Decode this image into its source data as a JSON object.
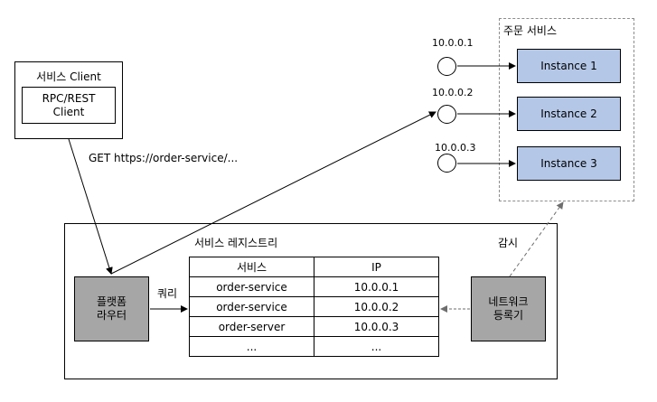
{
  "client": {
    "title": "서비스 Client",
    "inner_line1": "RPC/REST",
    "inner_line2": "Client"
  },
  "request_label": "GET https://order-service/...",
  "order_service": {
    "title": "주문 서비스",
    "instances": [
      {
        "ip": "10.0.0.1",
        "label": "Instance 1"
      },
      {
        "ip": "10.0.0.2",
        "label": "Instance 2"
      },
      {
        "ip": "10.0.0.3",
        "label": "Instance 3"
      }
    ]
  },
  "registry": {
    "title": "서비스 레지스트리",
    "headers": [
      "서비스",
      "IP"
    ],
    "rows": [
      [
        "order-service",
        "10.0.0.1"
      ],
      [
        "order-service",
        "10.0.0.2"
      ],
      [
        "order-server",
        "10.0.0.3"
      ],
      [
        "...",
        "..."
      ]
    ]
  },
  "router": {
    "line1": "플랫폼",
    "line2": "라우터"
  },
  "query_label": "쿼리",
  "monitor": {
    "line1": "네트워크",
    "line2": "등록기"
  },
  "watch_label": "감시",
  "colors": {
    "instance_fill": "#b4c7e7",
    "grey_box_fill": "#a6a6a6",
    "dashed_border": "#8c8c8c"
  }
}
